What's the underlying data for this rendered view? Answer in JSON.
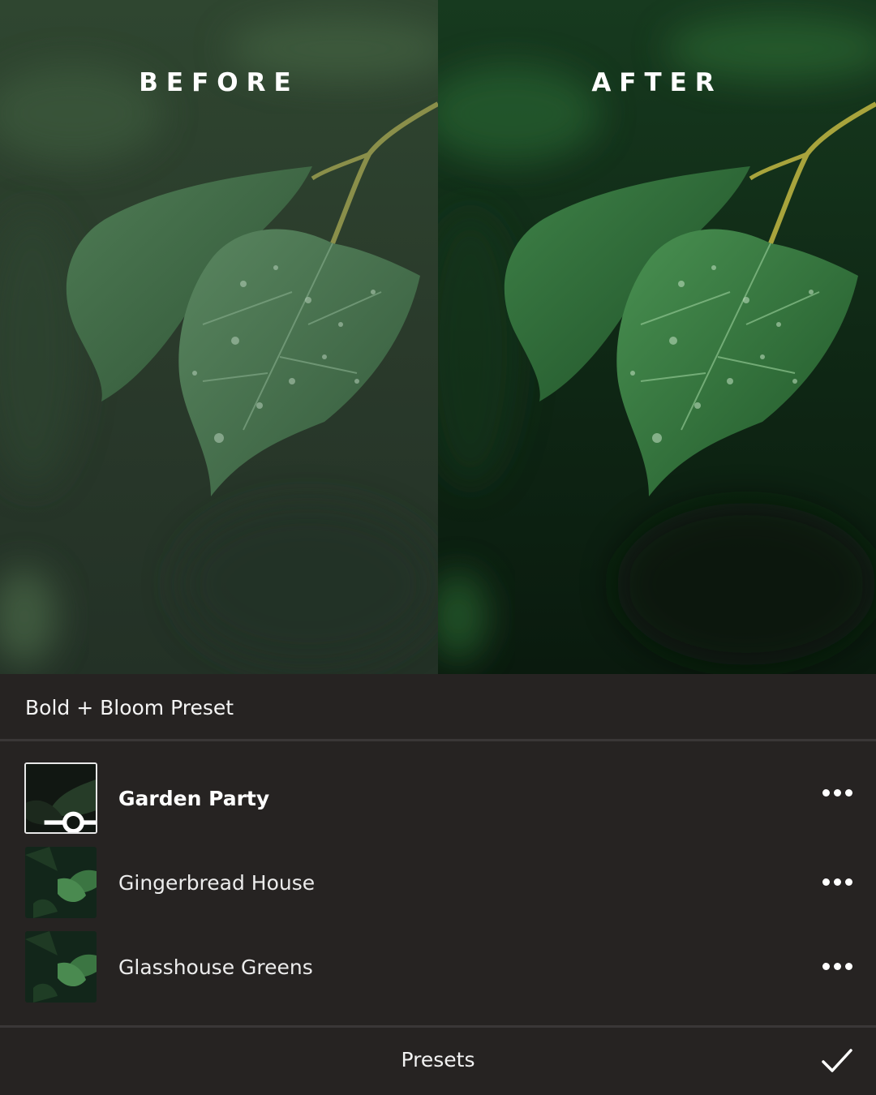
{
  "compare": {
    "before_label": "BEFORE",
    "after_label": "AFTER"
  },
  "preset_group": {
    "title": "Bold + Bloom Preset"
  },
  "presets": [
    {
      "name": "Garden Party",
      "selected": true,
      "icon": "adjust-sliders-icon"
    },
    {
      "name": "Gingerbread House",
      "selected": false
    },
    {
      "name": "Glasshouse Greens",
      "selected": false
    }
  ],
  "bottom_bar": {
    "title": "Presets",
    "confirm_icon": "checkmark-icon"
  },
  "colors": {
    "panel_bg": "#262322",
    "divider": "#3a3737",
    "text": "#f2f2f2"
  }
}
